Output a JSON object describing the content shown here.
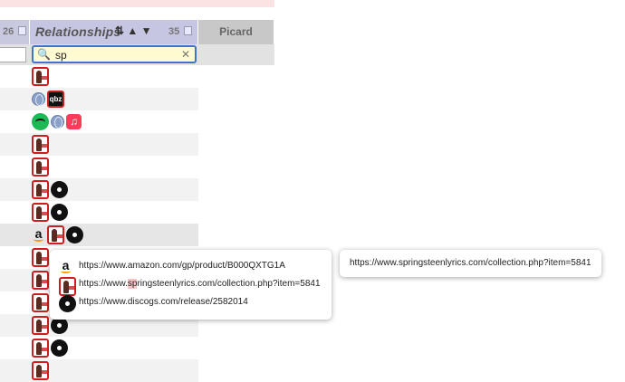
{
  "header": {
    "prev_count": "26",
    "relationships_title": "Relationships",
    "sort_glyphs": "⇅ ▲ ▼",
    "relationships_count": "35",
    "picard_title": "Picard"
  },
  "filter": {
    "search_value": "sp"
  },
  "rows": [
    {
      "icons": [
        "band"
      ]
    },
    {
      "icons": [
        "globe",
        "qobuz"
      ]
    },
    {
      "icons": [
        "spotify",
        "globe",
        "music"
      ]
    },
    {
      "icons": [
        "band"
      ]
    },
    {
      "icons": [
        "band"
      ]
    },
    {
      "icons": [
        "band",
        "disc"
      ]
    },
    {
      "icons": [
        "band",
        "disc"
      ]
    },
    {
      "icons": [
        "amazon",
        "band",
        "disc"
      ]
    },
    {
      "icons": [
        "band"
      ]
    },
    {
      "icons": [
        "band"
      ]
    },
    {
      "icons": [
        "band",
        "disc"
      ]
    },
    {
      "icons": [
        "band",
        "disc"
      ]
    },
    {
      "icons": [
        "band",
        "disc"
      ]
    },
    {
      "icons": [
        "band"
      ]
    }
  ],
  "popup": {
    "links": [
      {
        "icon": "amazon",
        "url": "https://www.amazon.com/gp/product/B000QXTG1A"
      },
      {
        "icon": "band",
        "url_prefix": "https://www.",
        "url_match": "sp",
        "url_suffix": "ringsteenlyrics.com/collection.php?item=5841"
      },
      {
        "icon": "disc",
        "url": "https://www.discogs.com/release/2582014"
      }
    ]
  },
  "tooltip": {
    "url": "https://www.springsteenlyrics.com/collection.php?item=5841"
  },
  "icon_names": {
    "band": "springsteenlyrics-icon",
    "disc": "discogs-icon",
    "globe": "globe-icon",
    "qobuz": "qobuz-icon",
    "spotify": "spotify-icon",
    "music": "apple-music-icon",
    "amazon": "amazon-icon"
  },
  "colors": {
    "accent_red": "#cc1e1e",
    "search_border": "#3f74c9",
    "search_bg": "#fffbd0"
  }
}
